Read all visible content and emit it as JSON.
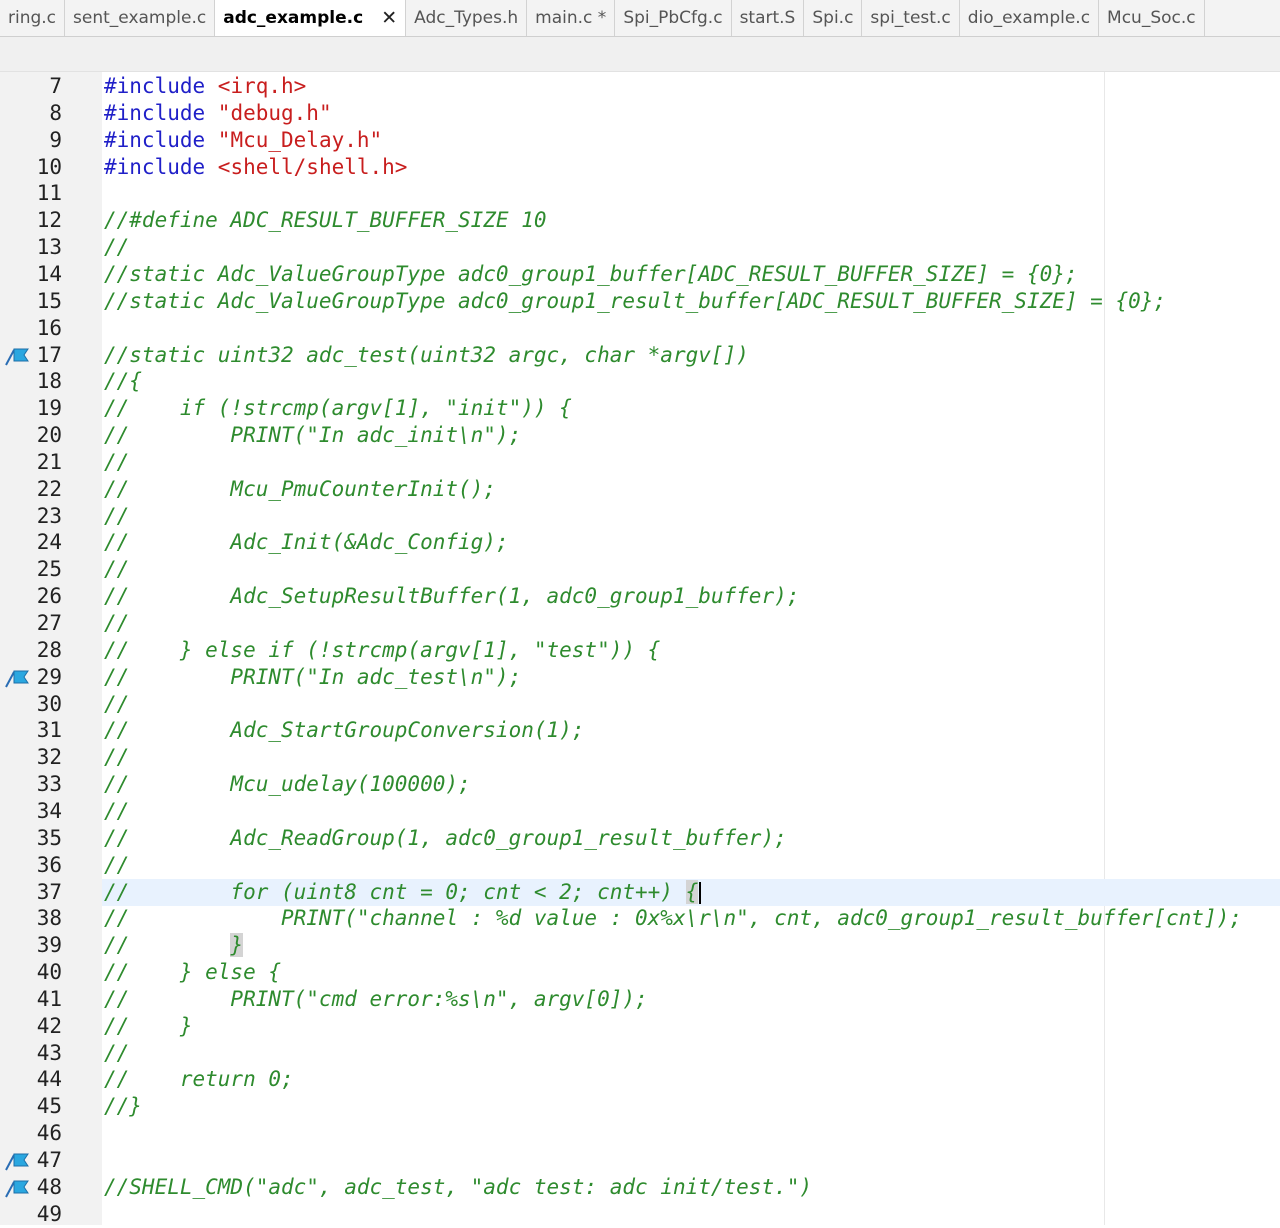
{
  "tabs": [
    {
      "label": "ring.c",
      "active": false
    },
    {
      "label": "sent_example.c",
      "active": false
    },
    {
      "label": "adc_example.c",
      "active": true
    },
    {
      "label": "Adc_Types.h",
      "active": false
    },
    {
      "label": "main.c *",
      "active": false
    },
    {
      "label": "Spi_PbCfg.c",
      "active": false
    },
    {
      "label": "start.S",
      "active": false
    },
    {
      "label": "Spi.c",
      "active": false
    },
    {
      "label": "spi_test.c",
      "active": false
    },
    {
      "label": "dio_example.c",
      "active": false
    },
    {
      "label": "Mcu_Soc.c",
      "active": false
    }
  ],
  "close_glyph": "✕",
  "current_line": 37,
  "colors": {
    "keyword": "#1f1fc8",
    "string": "#c81e1e",
    "comment": "#2e8b2e",
    "line_highlight": "#e8f2fe"
  },
  "lines": [
    {
      "n": "7",
      "bookmark": false,
      "tokens": [
        {
          "t": "kw",
          "v": "#include "
        },
        {
          "t": "str",
          "v": "<irq.h>"
        }
      ]
    },
    {
      "n": "8",
      "bookmark": false,
      "tokens": [
        {
          "t": "kw",
          "v": "#include "
        },
        {
          "t": "str",
          "v": "\"debug.h\""
        }
      ]
    },
    {
      "n": "9",
      "bookmark": false,
      "tokens": [
        {
          "t": "kw",
          "v": "#include "
        },
        {
          "t": "str",
          "v": "\"Mcu_Delay.h\""
        }
      ]
    },
    {
      "n": "10",
      "bookmark": false,
      "tokens": [
        {
          "t": "kw",
          "v": "#include "
        },
        {
          "t": "str",
          "v": "<shell/shell.h>"
        }
      ]
    },
    {
      "n": "11",
      "bookmark": false,
      "tokens": []
    },
    {
      "n": "12",
      "bookmark": false,
      "tokens": [
        {
          "t": "cm",
          "v": "//#define ADC_RESULT_BUFFER_SIZE 10"
        }
      ]
    },
    {
      "n": "13",
      "bookmark": false,
      "tokens": [
        {
          "t": "cm",
          "v": "//"
        }
      ]
    },
    {
      "n": "14",
      "bookmark": false,
      "tokens": [
        {
          "t": "cm",
          "v": "//static Adc_ValueGroupType adc0_group1_buffer[ADC_RESULT_BUFFER_SIZE] = {0};"
        }
      ]
    },
    {
      "n": "15",
      "bookmark": false,
      "tokens": [
        {
          "t": "cm",
          "v": "//static Adc_ValueGroupType adc0_group1_result_buffer[ADC_RESULT_BUFFER_SIZE] = {0};"
        }
      ]
    },
    {
      "n": "16",
      "bookmark": false,
      "tokens": []
    },
    {
      "n": "17",
      "bookmark": true,
      "tokens": [
        {
          "t": "cm",
          "v": "//static uint32 adc_test(uint32 argc, char *argv[])"
        }
      ]
    },
    {
      "n": "18",
      "bookmark": false,
      "tokens": [
        {
          "t": "cm",
          "v": "//{"
        }
      ]
    },
    {
      "n": "19",
      "bookmark": false,
      "tokens": [
        {
          "t": "cm",
          "v": "//    if (!strcmp(argv[1], \"init\")) {"
        }
      ]
    },
    {
      "n": "20",
      "bookmark": false,
      "tokens": [
        {
          "t": "cm",
          "v": "//        PRINT(\"In adc_init\\n\");"
        }
      ]
    },
    {
      "n": "21",
      "bookmark": false,
      "tokens": [
        {
          "t": "cm",
          "v": "//"
        }
      ]
    },
    {
      "n": "22",
      "bookmark": false,
      "tokens": [
        {
          "t": "cm",
          "v": "//        Mcu_PmuCounterInit();"
        }
      ]
    },
    {
      "n": "23",
      "bookmark": false,
      "tokens": [
        {
          "t": "cm",
          "v": "//"
        }
      ]
    },
    {
      "n": "24",
      "bookmark": false,
      "tokens": [
        {
          "t": "cm",
          "v": "//        Adc_Init(&Adc_Config);"
        }
      ]
    },
    {
      "n": "25",
      "bookmark": false,
      "tokens": [
        {
          "t": "cm",
          "v": "//"
        }
      ]
    },
    {
      "n": "26",
      "bookmark": false,
      "tokens": [
        {
          "t": "cm",
          "v": "//        Adc_SetupResultBuffer(1, adc0_group1_buffer);"
        }
      ]
    },
    {
      "n": "27",
      "bookmark": false,
      "tokens": [
        {
          "t": "cm",
          "v": "//"
        }
      ]
    },
    {
      "n": "28",
      "bookmark": false,
      "tokens": [
        {
          "t": "cm",
          "v": "//    } else if (!strcmp(argv[1], \"test\")) {"
        }
      ]
    },
    {
      "n": "29",
      "bookmark": true,
      "tokens": [
        {
          "t": "cm",
          "v": "//        PRINT(\"In adc_test\\n\");"
        }
      ]
    },
    {
      "n": "30",
      "bookmark": false,
      "tokens": [
        {
          "t": "cm",
          "v": "//"
        }
      ]
    },
    {
      "n": "31",
      "bookmark": false,
      "tokens": [
        {
          "t": "cm",
          "v": "//        Adc_StartGroupConversion(1);"
        }
      ]
    },
    {
      "n": "32",
      "bookmark": false,
      "tokens": [
        {
          "t": "cm",
          "v": "//"
        }
      ]
    },
    {
      "n": "33",
      "bookmark": false,
      "tokens": [
        {
          "t": "cm",
          "v": "//        Mcu_udelay(100000);"
        }
      ]
    },
    {
      "n": "34",
      "bookmark": false,
      "tokens": [
        {
          "t": "cm",
          "v": "//"
        }
      ]
    },
    {
      "n": "35",
      "bookmark": false,
      "tokens": [
        {
          "t": "cm",
          "v": "//        Adc_ReadGroup(1, adc0_group1_result_buffer);"
        }
      ]
    },
    {
      "n": "36",
      "bookmark": false,
      "tokens": [
        {
          "t": "cm",
          "v": "//"
        }
      ]
    },
    {
      "n": "37",
      "bookmark": false,
      "tokens": [
        {
          "t": "cm",
          "v": "//        for (uint8 cnt = 0; cnt < 2; cnt++) "
        },
        {
          "t": "cm bracket",
          "v": "{"
        },
        {
          "t": "caret",
          "v": ""
        }
      ]
    },
    {
      "n": "38",
      "bookmark": false,
      "tokens": [
        {
          "t": "cm",
          "v": "//            PRINT(\"channel : %d value : 0x%x\\r\\n\", cnt, adc0_group1_result_buffer[cnt]);"
        }
      ]
    },
    {
      "n": "39",
      "bookmark": false,
      "tokens": [
        {
          "t": "cm",
          "v": "//        "
        },
        {
          "t": "cm bracket",
          "v": "}"
        }
      ]
    },
    {
      "n": "40",
      "bookmark": false,
      "tokens": [
        {
          "t": "cm",
          "v": "//    } else {"
        }
      ]
    },
    {
      "n": "41",
      "bookmark": false,
      "tokens": [
        {
          "t": "cm",
          "v": "//        PRINT(\"cmd error:%s\\n\", argv[0]);"
        }
      ]
    },
    {
      "n": "42",
      "bookmark": false,
      "tokens": [
        {
          "t": "cm",
          "v": "//    }"
        }
      ]
    },
    {
      "n": "43",
      "bookmark": false,
      "tokens": [
        {
          "t": "cm",
          "v": "//"
        }
      ]
    },
    {
      "n": "44",
      "bookmark": false,
      "tokens": [
        {
          "t": "cm",
          "v": "//    return 0;"
        }
      ]
    },
    {
      "n": "45",
      "bookmark": false,
      "tokens": [
        {
          "t": "cm",
          "v": "//}"
        }
      ]
    },
    {
      "n": "46",
      "bookmark": false,
      "tokens": []
    },
    {
      "n": "47",
      "bookmark": true,
      "tokens": []
    },
    {
      "n": "48",
      "bookmark": true,
      "tokens": [
        {
          "t": "cm",
          "v": "//SHELL_CMD(\"adc\", adc_test, \"adc test: adc init/test.\")"
        }
      ]
    },
    {
      "n": "49",
      "bookmark": false,
      "tokens": []
    }
  ]
}
